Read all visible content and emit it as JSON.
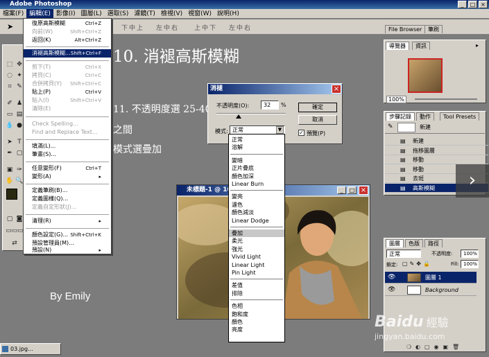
{
  "app": {
    "title": "Adobe Photoshop"
  },
  "menubar": [
    "檔案(F)",
    "編輯(E)",
    "影像(I)",
    "圖層(L)",
    "選取(S)",
    "濾鏡(T)",
    "檢視(V)",
    "視窗(W)",
    "說明(H)"
  ],
  "optbar": {
    "text1": "下中上",
    "text2": "左中右",
    "text3": "上中下",
    "text4": "左中右"
  },
  "edit_menu": {
    "items": [
      {
        "label": "復原高斯模糊",
        "shortcut": "Ctrl+Z",
        "disabled": false
      },
      {
        "label": "向前(W)",
        "shortcut": "Shift+Ctrl+Z",
        "disabled": true
      },
      {
        "label": "返回(K)",
        "shortcut": "Alt+Ctrl+Z",
        "disabled": false
      },
      {
        "label": "消褪高斯模糊...",
        "shortcut": "Shift+Ctrl+F",
        "selected": true
      },
      {
        "label": "剪下(T)",
        "shortcut": "Ctrl+X",
        "disabled": true
      },
      {
        "label": "拷貝(C)",
        "shortcut": "Ctrl+C",
        "disabled": true
      },
      {
        "label": "合併拷貝(Y)",
        "shortcut": "Shift+Ctrl+C",
        "disabled": true
      },
      {
        "label": "貼上(P)",
        "shortcut": "Ctrl+V",
        "disabled": false
      },
      {
        "label": "貼入(I)",
        "shortcut": "Shift+Ctrl+V",
        "disabled": true
      },
      {
        "label": "清除(E)",
        "shortcut": "",
        "disabled": true
      },
      {
        "label": "Check Spelling...",
        "shortcut": "",
        "disabled": true
      },
      {
        "label": "Find and Replace Text...",
        "shortcut": "",
        "disabled": true
      },
      {
        "label": "填滿(L)...",
        "shortcut": "",
        "disabled": false
      },
      {
        "label": "筆畫(S)...",
        "shortcut": "",
        "disabled": false
      },
      {
        "label": "任意變形(F)",
        "shortcut": "Ctrl+T",
        "disabled": false
      },
      {
        "label": "變形(A)",
        "shortcut": "▸",
        "disabled": false
      },
      {
        "label": "定義筆刷(B)...",
        "shortcut": "",
        "disabled": false
      },
      {
        "label": "定義圖樣(Q)...",
        "shortcut": "",
        "disabled": false
      },
      {
        "label": "定義自定形狀(J)...",
        "shortcut": "",
        "disabled": true
      },
      {
        "label": "清理(R)",
        "shortcut": "▸",
        "disabled": false
      },
      {
        "label": "顏色設定(G)...",
        "shortcut": "Shift+Ctrl+K",
        "disabled": false
      },
      {
        "label": "預設管理員(M)...",
        "shortcut": "",
        "disabled": false
      },
      {
        "label": "預設(N)",
        "shortcut": "▸",
        "disabled": false
      }
    ]
  },
  "slide": {
    "title": "10. 消褪高斯模糊",
    "line1": "11. 不透明度選 25-40",
    "line2": "之間",
    "line3": "模式選疊加",
    "byline": "By Emily"
  },
  "fade_dialog": {
    "title": "消褪",
    "opacity_label": "不透明度(O):",
    "opacity_value": "32",
    "opacity_unit": "%",
    "opacity_percent": 32,
    "mode_label": "模式:",
    "mode_value": "正常",
    "ok": "確定",
    "cancel": "取消",
    "preview": "預覽(P)",
    "preview_checked": true
  },
  "blend_modes": [
    [
      "正常",
      "溶解"
    ],
    [
      "變暗",
      "正片疊底",
      "顏色加深",
      "Linear Burn"
    ],
    [
      "變亮",
      "濾色",
      "顏色減淡",
      "Linear Dodge"
    ],
    [
      "疊加",
      "柔光",
      "強光",
      "Vivid Light",
      "Linear Light",
      "Pin Light"
    ],
    [
      "差值",
      "排除"
    ],
    [
      "色相",
      "飽和度",
      "顏色",
      "亮度"
    ]
  ],
  "blend_selected": "疊加",
  "photo_window": {
    "title": "未標題-1 @ 10..."
  },
  "panel_tabs": {
    "file_browser": "File Browser",
    "brushes": "筆刷"
  },
  "navigator": {
    "tabs": [
      "導覽器",
      "資訊"
    ],
    "zoom": "100%"
  },
  "history": {
    "tabs": [
      "步驟記錄",
      "動作",
      "Tool Presets"
    ],
    "snapshot": "新建",
    "items": [
      "新建",
      "拖移圖層",
      "移動",
      "移動",
      "去斑",
      "高斯模糊"
    ],
    "selected_index": 5
  },
  "layers": {
    "tabs": [
      "圖層",
      "色版",
      "路徑"
    ],
    "mode": "正常",
    "opacity_label": "不透明度:",
    "opacity": "100%",
    "lock_label": "鎖定:",
    "fill_label": "Fill:",
    "fill": "100%",
    "items": [
      "圖層 1",
      "Background"
    ],
    "selected_index": 0
  },
  "taskbar_item": "03.jpg...",
  "watermark": {
    "brand": "Baidu",
    "cn": "經驗",
    "url": "jingyan.baidu.com"
  },
  "colors": {
    "menu_highlight": "#0a246a",
    "foreground_swatch": "#2a2a12",
    "background_swatch": "#ffffff",
    "close_red": "#c8302c"
  }
}
